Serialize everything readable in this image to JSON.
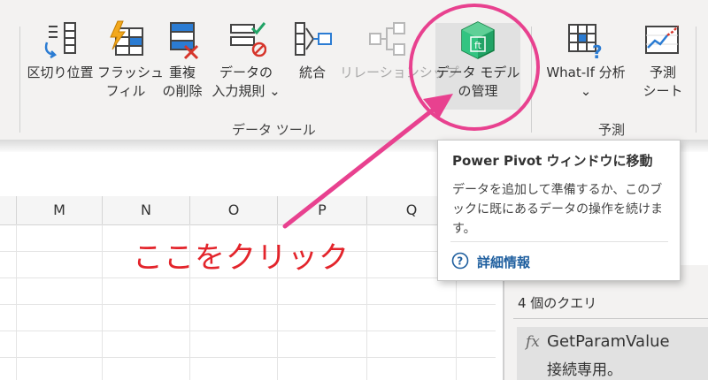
{
  "ribbon": {
    "buttons": {
      "text_to_columns": {
        "line1": "区切り位置",
        "line2": ""
      },
      "flash_fill": {
        "line1": "フラッシュ",
        "line2": "フィル"
      },
      "remove_duplicates": {
        "line1": "重複",
        "line2": "の削除"
      },
      "data_validation": {
        "line1": "データの",
        "line2": "入力規則 ⌄"
      },
      "consolidate": {
        "line1": "統合",
        "line2": ""
      },
      "relationships": {
        "line1": "リレーションシップ",
        "line2": ""
      },
      "data_model": {
        "line1": "データ モデル",
        "line2": "の管理"
      },
      "what_if": {
        "line1": "What-If 分析",
        "line2": "⌄"
      },
      "forecast": {
        "line1": "予測",
        "line2": "シート"
      }
    },
    "groups": {
      "data_tools": "データ ツール",
      "forecast": "予測"
    }
  },
  "sheet": {
    "columns": [
      "M",
      "N",
      "O",
      "P",
      "Q"
    ]
  },
  "tooltip": {
    "title": "Power Pivot ウィンドウに移動",
    "body": "データを追加して準備するか、このブックに既にあるデータの操作を続けます。",
    "help_link": "詳細情報"
  },
  "queries_pane": {
    "count_label": "4 個のクエリ",
    "items": [
      {
        "icon": "fx",
        "name": "GetParamValue",
        "description": "接続専用。"
      }
    ]
  },
  "annotation": {
    "text": "ここをクリック"
  },
  "colors": {
    "callout": "#e8418f",
    "annotation_text": "#e3242b",
    "link": "#1f5f9f",
    "excel_green": "#21a366"
  }
}
